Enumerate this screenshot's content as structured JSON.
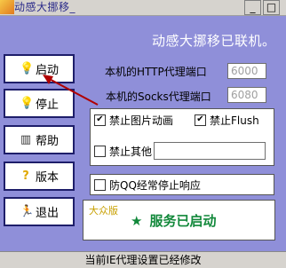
{
  "window": {
    "title": "动感大挪移_",
    "min_label": "_",
    "max_label": "□"
  },
  "header": {
    "status": "动感大挪移已联机。"
  },
  "sidebar": {
    "buttons": [
      {
        "label": "启动",
        "icon": "bulb-icon"
      },
      {
        "label": "停止",
        "icon": "bulb-off-icon"
      },
      {
        "label": "帮助",
        "icon": "books-icon"
      },
      {
        "label": "版本",
        "icon": "question-icon"
      },
      {
        "label": "退出",
        "icon": "exit-icon"
      }
    ]
  },
  "proxy": {
    "http_label": "本机的HTTP代理端口",
    "http_port": "6000",
    "socks_label": "本机的Socks代理端口",
    "socks_port": "6080"
  },
  "options": {
    "block_gif": {
      "label": "禁止图片动画",
      "checked": true,
      "mark": "✔"
    },
    "block_flash": {
      "label": "禁止Flush",
      "checked": true,
      "mark": "✔"
    },
    "block_other": {
      "label": "禁止其他",
      "checked": false,
      "value": ""
    },
    "qq_fix": {
      "label": "防QQ经常停止响应",
      "checked": false
    }
  },
  "service": {
    "tag": "大众版",
    "star": "★",
    "state": "服务已启动"
  },
  "statusbar": {
    "text": "当前IE代理设置已经修改"
  },
  "colors": {
    "background": "#8f8fd9",
    "service_text": "#11883a",
    "arrow": "#b00000"
  }
}
